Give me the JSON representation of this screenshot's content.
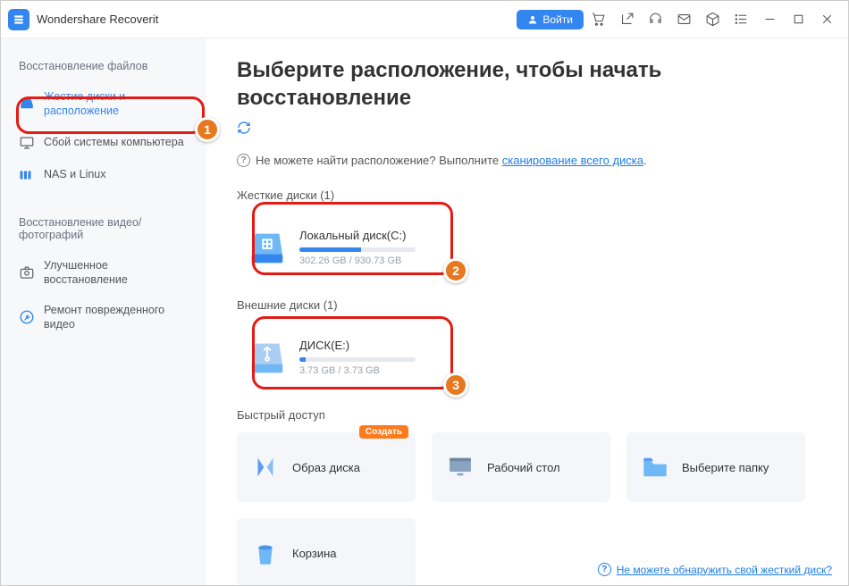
{
  "app": {
    "title": "Wondershare Recoverit"
  },
  "header": {
    "login": "Войти"
  },
  "sidebar": {
    "group1_title": "Восстановление файлов",
    "items1": [
      {
        "label": "Жестие диски и расположение"
      },
      {
        "label": "Сбой системы компьютера"
      },
      {
        "label": "NAS и Linux"
      }
    ],
    "group2_title": "Восстановление видео/фотографий",
    "items2": [
      {
        "label": "Улучшенное восстановление"
      },
      {
        "label": "Ремонт поврежденного видео"
      }
    ]
  },
  "main": {
    "title": "Выберите расположение, чтобы начать восстановление",
    "hint_prefix": "Не можете найти расположение? Выполните ",
    "hint_link": "сканирование всего диска",
    "sections": {
      "hdd": "Жесткие диски  (1)",
      "ext": "Внешние диски  (1)",
      "quick": "Быстрый доступ"
    },
    "disks_hdd": [
      {
        "name": "Локальный диск(C:)",
        "used": "302.26 GB",
        "total": "930.73 GB",
        "pct": 53
      }
    ],
    "disks_ext": [
      {
        "name": "ДИСК(E:)",
        "used": "3.73 GB",
        "total": "3.73 GB",
        "pct": 5
      }
    ],
    "quick": [
      {
        "label": "Образ диска",
        "badge": "Создать"
      },
      {
        "label": "Рабочий стол"
      },
      {
        "label": "Выберите папку"
      },
      {
        "label": "Корзина"
      }
    ],
    "footer_link": "Не можете обнаружить свой жесткий диск?"
  },
  "annotations": [
    "1",
    "2",
    "3"
  ]
}
